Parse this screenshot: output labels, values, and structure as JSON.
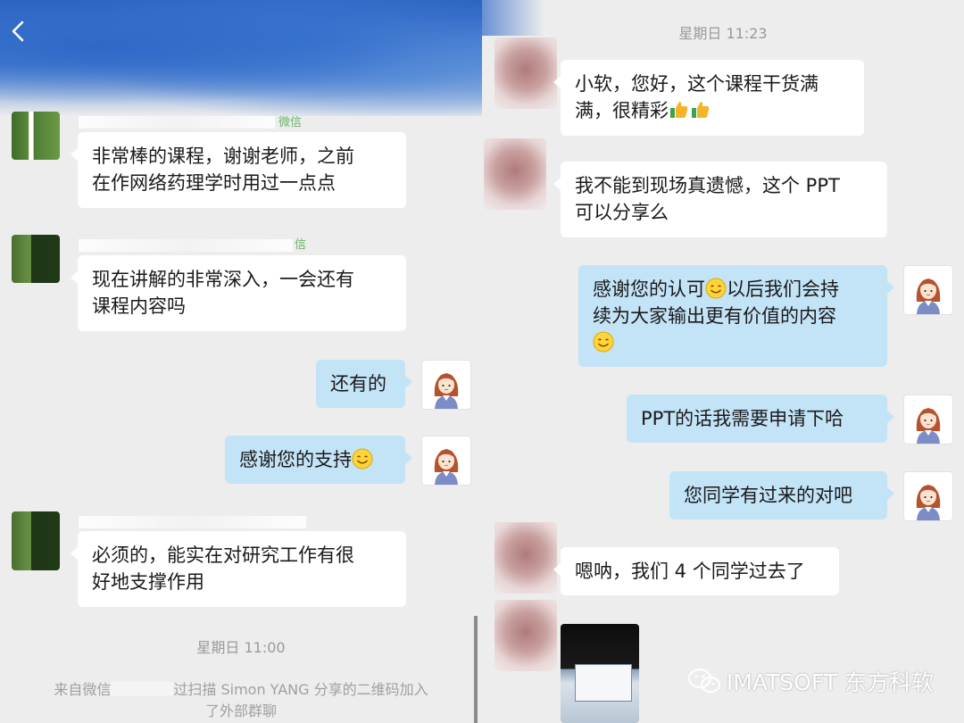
{
  "left": {
    "name_fragments": [
      "微信",
      "信"
    ],
    "messages": [
      {
        "lines": [
          "非常棒的课程，谢谢老师，之前",
          "在作网络药理学时用过一点点"
        ]
      },
      {
        "lines": [
          "现在讲解的非常深入，一会还有",
          "课程内容吗"
        ]
      },
      {
        "lines": [
          "还有的"
        ]
      },
      {
        "lines": [
          "感谢您的支持"
        ]
      },
      {
        "lines": [
          "必须的，能实在对研究工作有很",
          "好地支撑作用"
        ]
      }
    ],
    "time": "星期日 11:00",
    "system": {
      "part1": "来自微信",
      "part2": "过扫描 Simon YANG 分享的二维码加入",
      "part3": "了外部群聊"
    }
  },
  "right": {
    "time": "星期日 11:23",
    "messages": [
      {
        "lines": [
          "小软，您好，这个课程干货满",
          "满，很精彩"
        ]
      },
      {
        "lines": [
          "我不能到现场真遗憾，这个 PPT",
          "可以分享么"
        ]
      },
      {
        "lines": [
          "感谢您的认可",
          "以后我们会持",
          "续为大家输出更有价值的内容"
        ]
      },
      {
        "lines": [
          "PPT的话我需要申请下哈"
        ]
      },
      {
        "lines": [
          "您同学有过来的对吧"
        ]
      },
      {
        "lines": [
          "嗯呐，我们 4 个同学过去了"
        ]
      }
    ]
  },
  "watermark": {
    "text": "IMATSOFT 东方科软"
  },
  "colors": {
    "sent_bubble": "#c3e3f7",
    "received_bubble": "#ffffff",
    "background": "#ededed"
  },
  "icons": [
    "back-chevron-icon",
    "smile-emoji-icon",
    "thumbs-up-emoji-icon",
    "wechat-logo-icon"
  ]
}
